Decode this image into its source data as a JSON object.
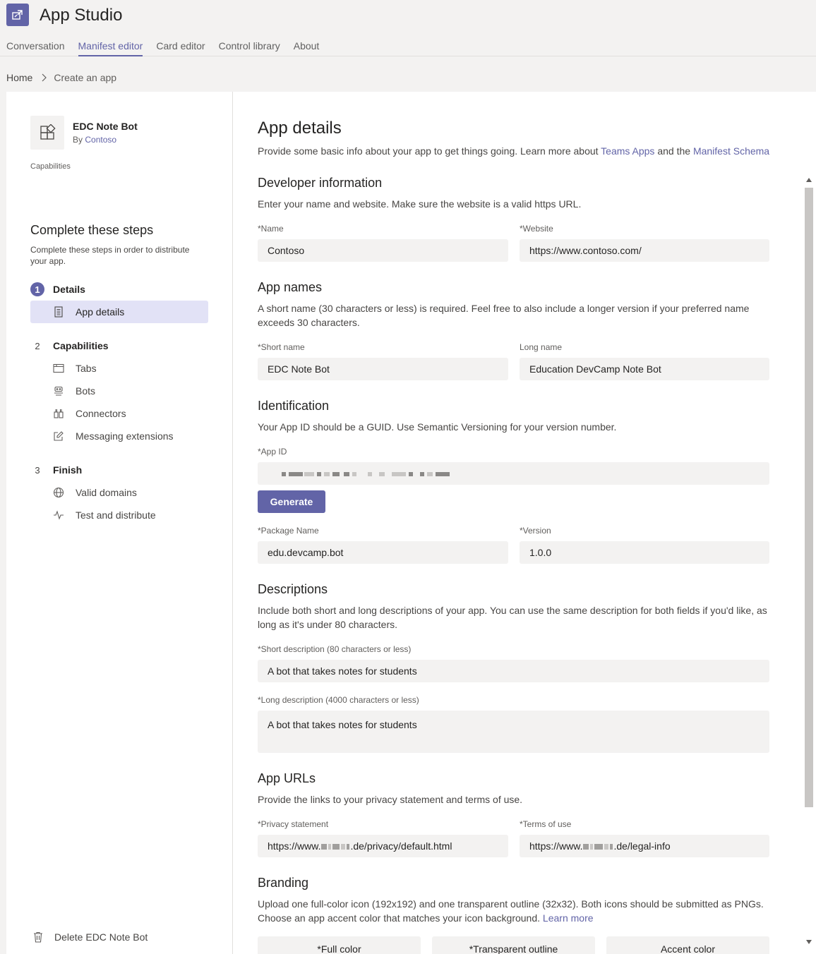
{
  "app": {
    "title": "App Studio",
    "logo_icon": "app-studio-icon",
    "accent": "#6264a7"
  },
  "tabs": [
    "Conversation",
    "Manifest editor",
    "Card editor",
    "Control library",
    "About"
  ],
  "active_tab": "Manifest editor",
  "breadcrumb": {
    "home": "Home",
    "current": "Create an app"
  },
  "sidebar": {
    "app_name": "EDC Note Bot",
    "by_prefix": "By",
    "developer": "Contoso",
    "capabilities_label": "Capabilities",
    "steps_title": "Complete these steps",
    "steps_desc": "Complete these steps in order to distribute your app.",
    "steps": [
      {
        "num": "1",
        "title": "Details",
        "items": [
          {
            "label": "App details",
            "icon": "document-icon"
          }
        ]
      },
      {
        "num": "2",
        "title": "Capabilities",
        "items": [
          {
            "label": "Tabs",
            "icon": "tab-icon"
          },
          {
            "label": "Bots",
            "icon": "bot-icon"
          },
          {
            "label": "Connectors",
            "icon": "connector-icon"
          },
          {
            "label": "Messaging extensions",
            "icon": "edit-icon"
          }
        ]
      },
      {
        "num": "3",
        "title": "Finish",
        "items": [
          {
            "label": "Valid domains",
            "icon": "globe-icon"
          },
          {
            "label": "Test and distribute",
            "icon": "activity-icon"
          }
        ]
      }
    ],
    "delete_label": "Delete EDC Note Bot"
  },
  "main": {
    "title": "App details",
    "intro_prefix": "Provide some basic info about your app to get things going. Learn more about ",
    "intro_link1": "Teams Apps",
    "intro_mid": " and the ",
    "intro_link2": "Manifest Schema",
    "developer": {
      "title": "Developer information",
      "desc": "Enter your name and website. Make sure the website is a valid https URL.",
      "name_label": "*Name",
      "name_value": "Contoso",
      "website_label": "*Website",
      "website_value": "https://www.contoso.com/"
    },
    "names": {
      "title": "App names",
      "desc": "A short name (30 characters or less) is required. Feel free to also include a longer version if your preferred name exceeds 30 characters.",
      "short_label": "*Short name",
      "short_value": "EDC Note Bot",
      "long_label": "Long name",
      "long_value": "Education DevCamp Note Bot"
    },
    "identification": {
      "title": "Identification",
      "desc": "Your App ID should be a GUID. Use Semantic Versioning for your version number.",
      "appid_label": "*App ID",
      "generate_label": "Generate",
      "package_label": "*Package Name",
      "package_value": "edu.devcamp.bot",
      "version_label": "*Version",
      "version_value": "1.0.0"
    },
    "descriptions": {
      "title": "Descriptions",
      "desc": "Include both short and long descriptions of your app. You can use the same description for both fields if you'd like, as long as it's under 80 characters.",
      "short_label": "*Short description (80 characters or less)",
      "short_value": "A bot that takes notes for students",
      "long_label": "*Long description (4000 characters or less)",
      "long_value": "A bot that takes notes for students"
    },
    "urls": {
      "title": "App URLs",
      "desc": "Provide the links to your privacy statement and terms of use.",
      "privacy_label": "*Privacy statement",
      "privacy_prefix": "https://www.",
      "privacy_suffix": ".de/privacy/default.html",
      "terms_label": "*Terms of use",
      "terms_prefix": "https://www.",
      "terms_suffix": ".de/legal-info"
    },
    "branding": {
      "title": "Branding",
      "desc": "Upload one full-color icon (192x192) and one transparent outline (32x32). Both icons should be submitted as PNGs. Choose an app accent color that matches your icon background.",
      "learn_more": "Learn more",
      "full_color": "*Full color",
      "outline": "*Transparent outline",
      "accent": "Accent color"
    }
  }
}
